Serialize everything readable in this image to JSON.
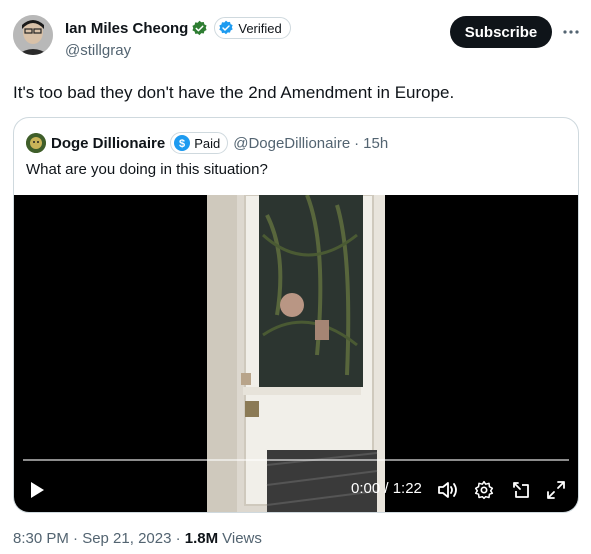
{
  "author": {
    "display_name": "Ian Miles Cheong",
    "handle": "@stillgray",
    "verified_label": "Verified",
    "subscribe_label": "Subscribe"
  },
  "tweet": {
    "text": "It's too bad they don't have the 2nd Amendment in Europe."
  },
  "quoted": {
    "display_name": "Doge Dillionaire",
    "paid_label": "Paid",
    "handle": "@DogeDillionaire",
    "separator": "·",
    "age": "15h",
    "text": "What are you doing in this situation?"
  },
  "video": {
    "time": "0:00 / 1:22",
    "progress": 0.0
  },
  "footer": {
    "timestamp": "8:30 PM · Sep 21, 2023 · ",
    "views_count": "1.8M",
    "views_label": "Views"
  },
  "colors": {
    "accent": "#1d9bf0",
    "text": "#0f1419",
    "secondary": "#536471",
    "gov_badge": "#2e7d32"
  },
  "icons": [
    "more-icon",
    "verified-check-icon",
    "paid-coin-icon",
    "play-icon",
    "volume-icon",
    "settings-icon",
    "pip-icon",
    "fullscreen-icon"
  ]
}
